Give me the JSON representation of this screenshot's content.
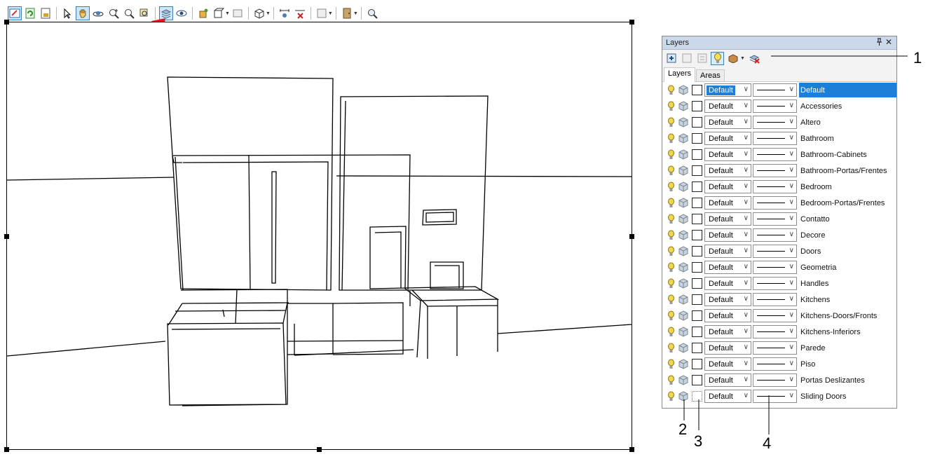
{
  "layers_panel": {
    "title": "Layers",
    "pin_icon": "pin-icon",
    "close_label": "✕",
    "tabs": [
      {
        "label": "Layers"
      },
      {
        "label": "Areas"
      }
    ],
    "rows": [
      {
        "name": "Default",
        "material": "Default"
      },
      {
        "name": "Accessories",
        "material": "Default"
      },
      {
        "name": "Altero",
        "material": "Default"
      },
      {
        "name": "Bathroom",
        "material": "Default"
      },
      {
        "name": "Bathroom-Cabinets",
        "material": "Default"
      },
      {
        "name": "Bathroom-Portas/Frentes",
        "material": "Default"
      },
      {
        "name": "Bedroom",
        "material": "Default"
      },
      {
        "name": "Bedroom-Portas/Frentes",
        "material": "Default"
      },
      {
        "name": "Contatto",
        "material": "Default"
      },
      {
        "name": "Decore",
        "material": "Default"
      },
      {
        "name": "Doors",
        "material": "Default"
      },
      {
        "name": "Geometria",
        "material": "Default"
      },
      {
        "name": "Handles",
        "material": "Default"
      },
      {
        "name": "Kitchens",
        "material": "Default"
      },
      {
        "name": "Kitchens-Doors/Fronts",
        "material": "Default"
      },
      {
        "name": "Kitchens-Inferiors",
        "material": "Default"
      },
      {
        "name": "Parede",
        "material": "Default"
      },
      {
        "name": "Piso",
        "material": "Default"
      },
      {
        "name": "Portas Deslizantes",
        "material": "Default"
      },
      {
        "name": "Sliding Doors",
        "material": "Default"
      }
    ]
  },
  "callouts": {
    "c1": "1",
    "c2": "2",
    "c3": "3",
    "c4": "4"
  },
  "colors": {
    "selection": "#1e7fd9",
    "panel_title": "#cad8ea",
    "arrow": "#e8141b",
    "bulb": "#f2d64b"
  }
}
